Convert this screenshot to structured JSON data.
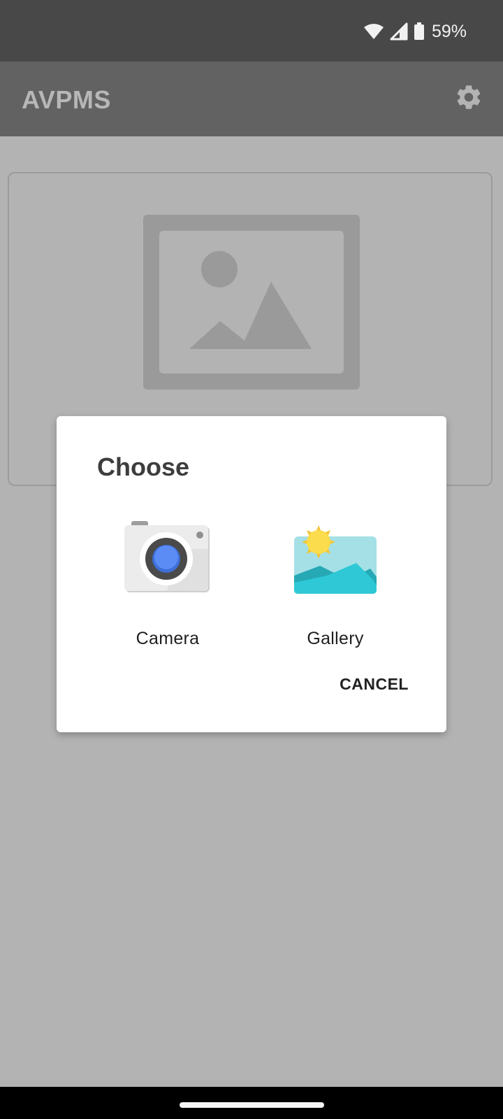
{
  "status_bar": {
    "battery_text": "59%",
    "icons": [
      "wifi-icon",
      "cellular-signal-icon",
      "battery-icon"
    ]
  },
  "app_bar": {
    "title": "AVPMS",
    "settings_icon": "gear-icon"
  },
  "image_card": {
    "placeholder_icon": "image-placeholder-icon"
  },
  "dialog": {
    "title": "Choose",
    "options": [
      {
        "label": "Camera",
        "icon": "camera-app-icon"
      },
      {
        "label": "Gallery",
        "icon": "gallery-app-icon"
      }
    ],
    "cancel_label": "CANCEL"
  },
  "colors": {
    "scrim_background": "#b3b3b3",
    "status_bar": "#484848",
    "app_bar": "#636263",
    "dialog_background": "#ffffff",
    "camera_lens": "#5b8cf5",
    "gallery_sky": "#a5e0e6",
    "gallery_sun": "#fbdc4c"
  }
}
